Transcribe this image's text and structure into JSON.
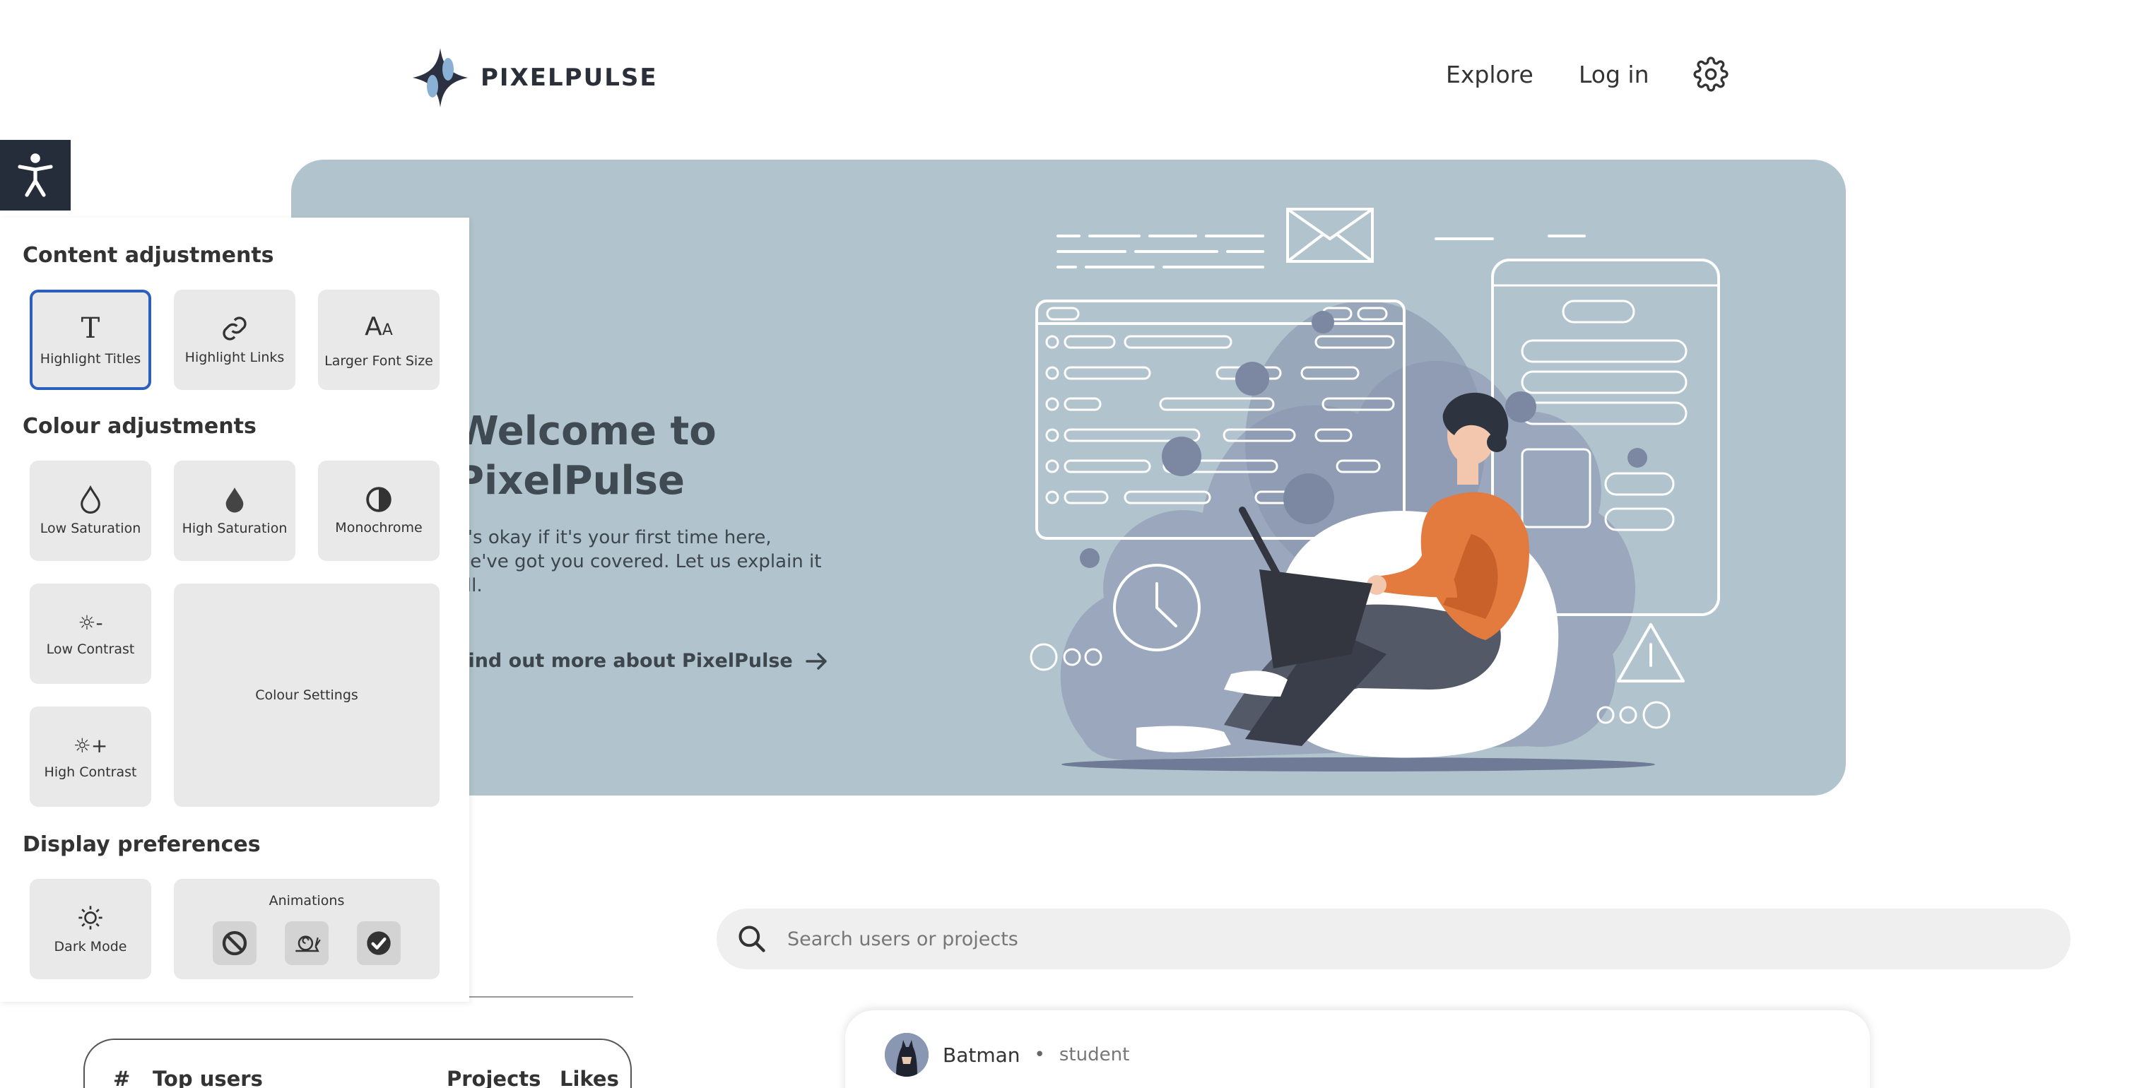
{
  "header": {
    "brand": "PIXELPULSE",
    "nav": {
      "explore": "Explore",
      "login": "Log in"
    }
  },
  "hero": {
    "title": "Welcome to PixelPulse",
    "text": "It's okay if it's your first time here, we've got you covered. Let us explain it all.",
    "link": "Find out more about PixelPulse"
  },
  "a11y_panel": {
    "content_heading": "Content adjustments",
    "content_tiles": [
      "Highlight Titles",
      "Highlight Links",
      "Larger Font Size"
    ],
    "colour_heading": "Colour adjustments",
    "colour_tiles": [
      "Low Saturation",
      "High Saturation",
      "Monochrome",
      "Low Contrast",
      "High Contrast",
      "Colour Settings"
    ],
    "display_heading": "Display preferences",
    "dark_mode": "Dark Mode",
    "animations": "Animations"
  },
  "search": {
    "placeholder": "Search users or projects"
  },
  "top_users": {
    "hash": "#",
    "title": "Top users",
    "projects": "Projects",
    "likes": "Likes"
  },
  "feed": {
    "name": "Batman",
    "separator": "•",
    "role": "student"
  },
  "colors": {
    "hero_bg": "#b1c3cc",
    "accent_orange": "#e37a3e",
    "panel_toggle": "#252d3a",
    "active_border": "#2b5fbd"
  }
}
